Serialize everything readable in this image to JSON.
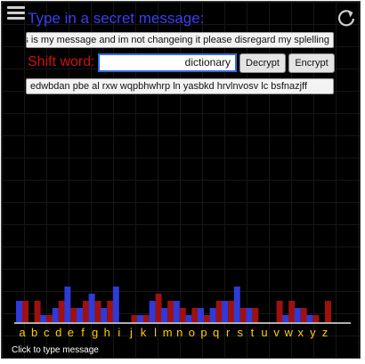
{
  "header": {
    "title": "Type in a secret message:",
    "menu_icon": "hamburger-menu-icon",
    "reset_icon": "refresh-icon"
  },
  "message_input": {
    "value": "This is my message and im not changeing it please disregard my splelling"
  },
  "shift": {
    "label": "Shift word:",
    "value": "dictionary"
  },
  "buttons": {
    "decrypt": "Decrypt",
    "encrypt": "Encrypt"
  },
  "output": {
    "value": "edwbdan pbe al rxw wqpbhwhrp ln yasbkd hrvlnvosv lc bsfnazjff"
  },
  "footer": {
    "hint": "Click to type message"
  },
  "colors": {
    "title": "#3a3ff5",
    "shift_label": "#d01010",
    "series_original": "#2f3ad8",
    "series_encrypted": "#a01010",
    "letters": "#ffd000"
  },
  "chart_data": {
    "type": "bar",
    "categories": [
      "a",
      "b",
      "c",
      "d",
      "e",
      "f",
      "g",
      "h",
      "i",
      "j",
      "k",
      "l",
      "m",
      "n",
      "o",
      "p",
      "q",
      "r",
      "s",
      "t",
      "u",
      "v",
      "w",
      "x",
      "y",
      "z"
    ],
    "series": [
      {
        "values": [
          3,
          0,
          1,
          2,
          5,
          2,
          4,
          2,
          5,
          0,
          1,
          3,
          2,
          3,
          1,
          2,
          2,
          3,
          5,
          2,
          0,
          0,
          1,
          2,
          1,
          0
        ]
      },
      {
        "values": [
          3,
          3,
          1,
          3,
          2,
          3,
          3,
          3,
          0,
          1,
          1,
          4,
          3,
          2,
          2,
          1,
          3,
          3,
          2,
          2,
          0,
          3,
          3,
          2,
          1,
          3
        ]
      }
    ],
    "ylim": [
      0,
      10
    ]
  }
}
